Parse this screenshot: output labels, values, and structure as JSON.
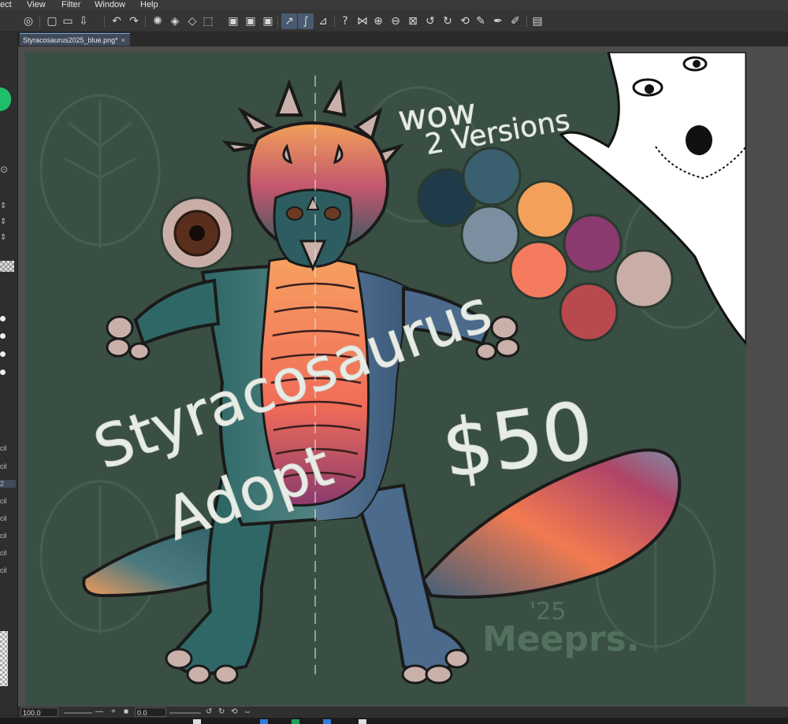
{
  "menu": {
    "items": [
      "ect",
      "View",
      "Filter",
      "Window",
      "Help"
    ]
  },
  "toolbar": {
    "icons": [
      "app-logo-icon",
      "new-file-icon",
      "open-folder-icon",
      "save-icon",
      "undo-icon",
      "redo-icon",
      "spinner-icon",
      "fill-icon",
      "transform-icon",
      "select-icon",
      "lasso-icon",
      "ruler-icon",
      "snap-icon",
      "symmetry-icon",
      "zoom-in-icon",
      "zoom-out-icon",
      "fit-icon",
      "rotate-left-icon",
      "rotate-right-icon",
      "reset-rotation-icon",
      "eyedropper-icon",
      "pen-icon",
      "marker-icon",
      "panel-icon"
    ]
  },
  "document": {
    "tab_label": "Styracosaurus2025_blue.png*",
    "close_glyph": "×"
  },
  "artwork": {
    "title_line1": "Styracosaurus",
    "title_line2": "Adopt",
    "price": "$50",
    "wow": "wow",
    "versions": "2 Versions",
    "signature_year": "'25",
    "signature_name": "Meeprs.",
    "swatches": [
      "#1f3b4a",
      "#3a5f6e",
      "#7b8fa0",
      "#f2a05a",
      "#f47b5e",
      "#8a3a6e",
      "#b8494f",
      "#c8aea6"
    ],
    "eye_color": "#5a2e1c"
  },
  "status": {
    "zoom": "100.0",
    "rotation": "0.0",
    "minus_glyph": "—",
    "plus_glyph": "+"
  },
  "left_panel": {
    "labels": [
      "cil",
      "cil",
      "2",
      "cil",
      "cil",
      "cil",
      "cil",
      "cil"
    ]
  }
}
